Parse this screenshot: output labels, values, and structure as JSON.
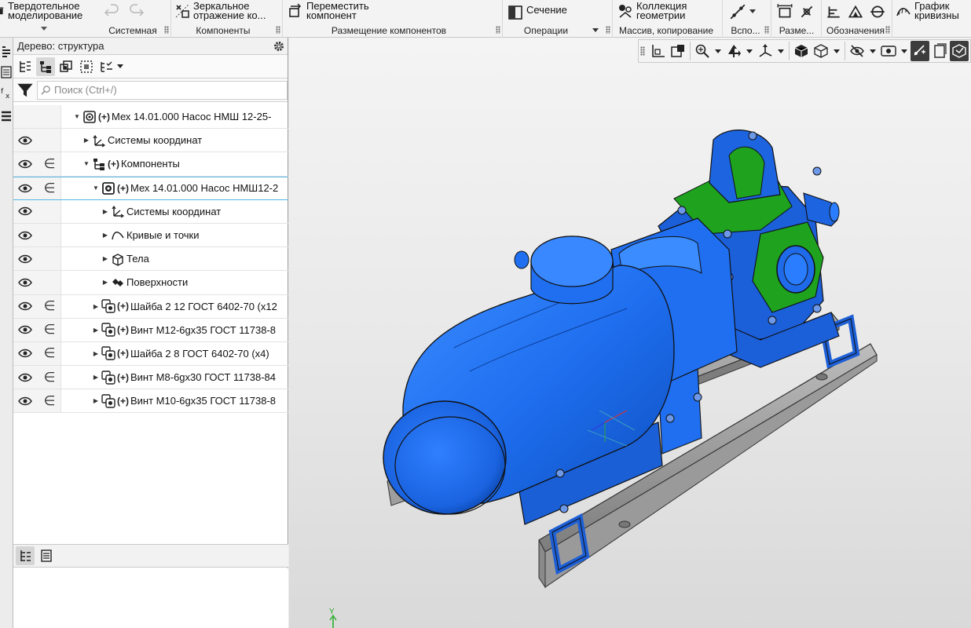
{
  "ribbon": {
    "solid_modeling": "Твердотельное\nмоделирование",
    "system_caption": "Системная",
    "mirror": "Зеркальное\nотражение ко...",
    "components_caption": "Компоненты",
    "move": "Переместить\nкомпонент",
    "placement_caption": "Размещение компонентов",
    "section": "Сечение",
    "operations_caption": "Операции",
    "collection": "Коллекция\nгеометрии",
    "array_caption": "Массив, копирование",
    "aux_caption": "Вспо...",
    "dims_caption": "Разме...",
    "notation_caption": "Обозначения",
    "curvature": "График\nкривизны"
  },
  "tree": {
    "title": "Дерево: структура",
    "search_placeholder": "Поиск (Ctrl+/)",
    "rows": [
      {
        "label": "Мех 14.01.000 Насос НМШ 12-25-",
        "plus": "(+)"
      },
      {
        "label": "Системы координат",
        "plus": ""
      },
      {
        "label": "Компоненты",
        "plus": "(+)"
      },
      {
        "label": "Мех 14.01.000 Насос НМШ12-2",
        "plus": "(+)"
      },
      {
        "label": "Системы координат",
        "plus": ""
      },
      {
        "label": "Кривые и точки",
        "plus": ""
      },
      {
        "label": "Тела",
        "plus": ""
      },
      {
        "label": "Поверхности",
        "plus": ""
      },
      {
        "label": "Шайба 2 12 ГОСТ 6402-70 (x12",
        "plus": "(+)"
      },
      {
        "label": "Винт М12-6gx35 ГОСТ 11738-8",
        "plus": "(+)"
      },
      {
        "label": "Шайба 2 8 ГОСТ 6402-70 (x4)",
        "plus": "(+)"
      },
      {
        "label": "Винт М8-6gx30 ГОСТ 11738-84",
        "plus": "(+)"
      },
      {
        "label": "Винт М10-6gx35 ГОСТ 11738-8",
        "plus": "(+)"
      }
    ],
    "in_symbol": "∈"
  },
  "viewport": {
    "axis_label": "Y"
  },
  "colors": {
    "accent_selection": "#52b8e0",
    "motor_blue": "#1f6ff0",
    "gearbox_green": "#1fa31f",
    "frame_grey": "#9b9b9b"
  }
}
